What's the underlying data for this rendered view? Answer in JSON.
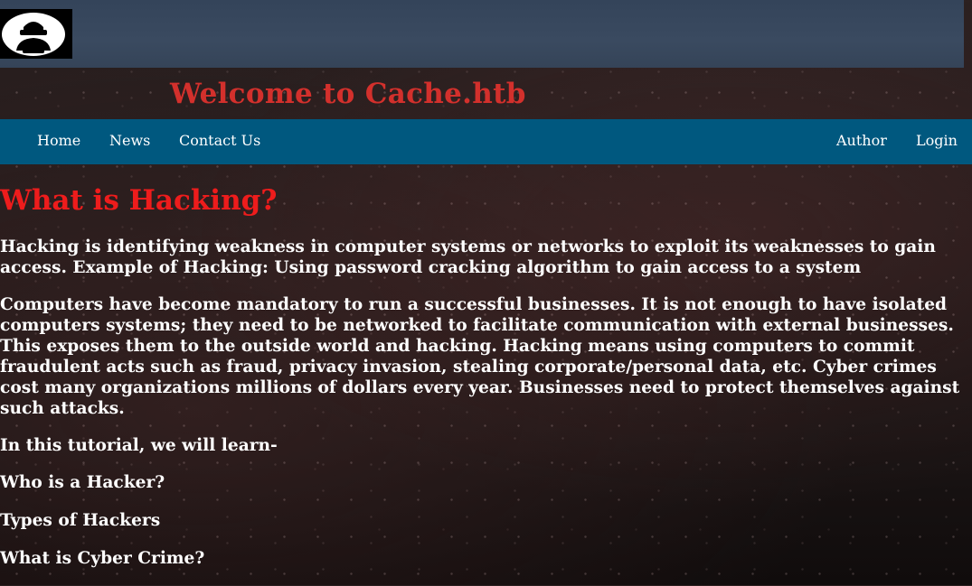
{
  "header": {
    "logo_icon": "hacker-icon",
    "title": "Welcome to Cache.htb"
  },
  "nav": {
    "left": [
      {
        "label": "Home"
      },
      {
        "label": "News"
      },
      {
        "label": "Contact Us"
      }
    ],
    "right": [
      {
        "label": "Author"
      },
      {
        "label": "Login"
      }
    ]
  },
  "main": {
    "heading": "What is Hacking?",
    "paragraphs": [
      "Hacking is identifying weakness in computer systems or networks to exploit its weaknesses to gain access. Example of Hacking: Using password cracking algorithm to gain access to a system",
      "Computers have become mandatory to run a successful businesses. It is not enough to have isolated computers systems; they need to be networked to facilitate communication with external businesses. This exposes them to the outside world and hacking. Hacking means using computers to commit fraudulent acts such as fraud, privacy invasion, stealing corporate/personal data, etc. Cyber crimes cost many organizations millions of dollars every year. Businesses need to protect themselves against such attacks.",
      "In this tutorial, we will learn-"
    ],
    "topics": [
      "Who is a Hacker?",
      "Types of Hackers",
      "What is Cyber Crime?"
    ]
  },
  "colors": {
    "title": "#d3302c",
    "heading": "#ee1c1c",
    "navbar": "#00587f",
    "top_band": "#34445a",
    "text": "#ffffff"
  }
}
